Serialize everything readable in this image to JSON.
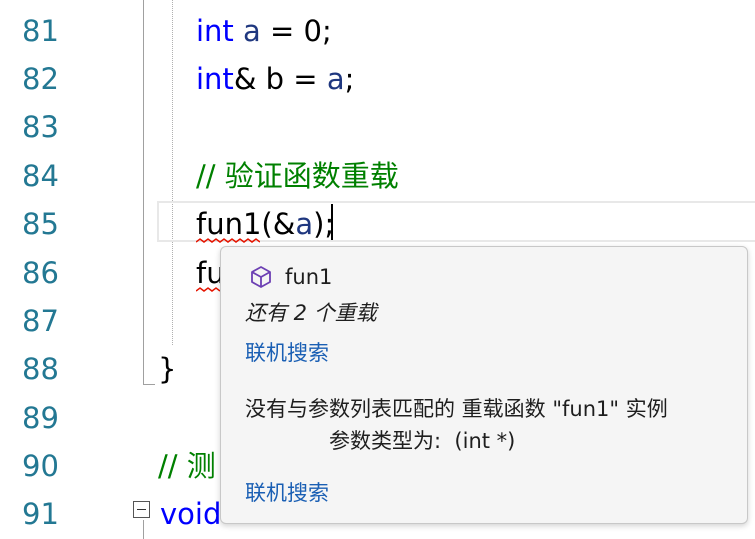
{
  "editor": {
    "line_numbers": [
      "81",
      "82",
      "83",
      "84",
      "85",
      "86",
      "87",
      "88",
      "89",
      "90",
      "91"
    ],
    "lines": {
      "l81": {
        "kw": "int",
        "rest_pre": " ",
        "var": "a",
        "rest": " = 0;"
      },
      "l82": {
        "kw": "int",
        "amp": "&",
        "rest_pre": " b = ",
        "var": "a",
        "rest": ";"
      },
      "l84": {
        "comment": "// 验证函数重载"
      },
      "l85": {
        "text": "fun1(&",
        "var": "a",
        "rest": ");"
      },
      "l86": {
        "text": "fu"
      },
      "l88": {
        "text": "}"
      },
      "l90": {
        "comment": "// 测"
      },
      "l91": {
        "kw": "void"
      }
    },
    "colors": {
      "line_number": "#237893",
      "keyword": "#0000ff",
      "variable": "#1f377f",
      "comment": "#008000",
      "squiggle": "#e51400"
    }
  },
  "tooltip": {
    "icon": "cube-icon",
    "name": "fun1",
    "overloads": "还有 2 个重载",
    "search_link_1": "联机搜索",
    "error_line": "没有与参数列表匹配的 重载函数 \"fun1\" 实例",
    "error_detail": "参数类型为:  (int *)",
    "search_link_2": "联机搜索"
  }
}
